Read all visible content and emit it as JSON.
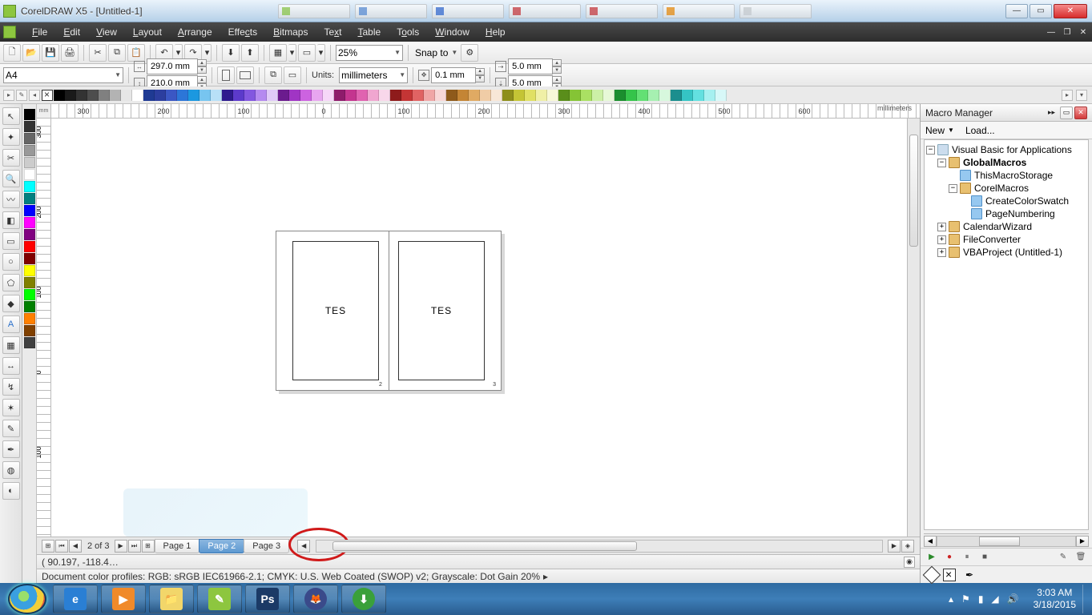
{
  "titlebar": {
    "title": "CorelDRAW X5 - [Untitled-1]",
    "tabs": [
      "",
      "",
      "",
      "",
      "",
      "",
      ""
    ]
  },
  "menu": {
    "items": [
      "File",
      "Edit",
      "View",
      "Layout",
      "Arrange",
      "Effects",
      "Bitmaps",
      "Text",
      "Table",
      "Tools",
      "Window",
      "Help"
    ]
  },
  "toolbar1": {
    "zoom": "25%",
    "snap_label": "Snap to"
  },
  "propbar": {
    "pagesize": "A4",
    "width": "297.0 mm",
    "height": "210.0 mm",
    "units_label": "Units:",
    "units": "millimeters",
    "nudge": "0.1 mm",
    "dup_x": "5.0 mm",
    "dup_y": "5.0 mm"
  },
  "palette": {
    "colors": [
      "#000000",
      "#1a1a1a",
      "#333333",
      "#4d4d4d",
      "#808080",
      "#b3b3b3",
      "#e6e6e6",
      "#ffffff",
      "#1f3a93",
      "#2c3e9f",
      "#3b57c4",
      "#2c76d8",
      "#1b98e0",
      "#77c5f0",
      "#b8e0f7",
      "#2e1b8e",
      "#5c3acb",
      "#8357e0",
      "#b58af0",
      "#e0caf8",
      "#6b1b8e",
      "#a035c4",
      "#cc63e0",
      "#e8a6f0",
      "#f6d7f8",
      "#8e1b6b",
      "#c4358f",
      "#e063b0",
      "#f0a6d0",
      "#f8d7ea",
      "#8e1b1b",
      "#c43535",
      "#e06363",
      "#f0a6a6",
      "#f8d7d7",
      "#8e5a1b",
      "#c48535",
      "#e0aa63",
      "#f0cca6",
      "#f8e7d7",
      "#8e8e1b",
      "#c4c435",
      "#e0e063",
      "#f0f0a6",
      "#f8f8d7",
      "#5a8e1b",
      "#85c435",
      "#aae063",
      "#ccf0a6",
      "#e7f8d7",
      "#1b8e2e",
      "#35c44a",
      "#63e074",
      "#a6f0b1",
      "#d7f8dd",
      "#1b8e8e",
      "#35c4c4",
      "#63e0e0",
      "#a6f0f0",
      "#d7f8f8"
    ]
  },
  "sidepalette": {
    "colors": [
      "#000000",
      "#333333",
      "#666666",
      "#999999",
      "#cccccc",
      "#ffffff",
      "#00ffff",
      "#008080",
      "#0000ff",
      "#ff00ff",
      "#800080",
      "#ff0000",
      "#800000",
      "#ffff00",
      "#808000",
      "#00ff00",
      "#008000",
      "#ff8000",
      "#804000",
      "#404040"
    ]
  },
  "ruler": {
    "unit": "millimeters",
    "h_ticks": [
      "300",
      "200",
      "100",
      "0",
      "100",
      "200",
      "300",
      "400",
      "500",
      "600"
    ],
    "v_ticks": [
      "300",
      "200",
      "100",
      "0",
      "100"
    ]
  },
  "canvas": {
    "page_left_text": "TES",
    "page_right_text": "TES",
    "page_left_num": "2",
    "page_right_num": "3"
  },
  "pagetabs": {
    "count": "2 of 3",
    "tabs": [
      "Page 1",
      "Page 2",
      "Page 3"
    ],
    "active_index": 1
  },
  "status": {
    "coords": "( 90.197, -118.4…",
    "profiles": "Document color profiles: RGB: sRGB IEC61966-2.1; CMYK: U.S. Web Coated (SWOP) v2; Grayscale: Dot Gain 20%"
  },
  "docker": {
    "title": "Macro Manager",
    "new": "New",
    "load": "Load...",
    "tree": {
      "root": "Visual Basic for Applications",
      "global": "GlobalMacros",
      "storage": "ThisMacroStorage",
      "corel": "CorelMacros",
      "swatch": "CreateColorSwatch",
      "pagenum": "PageNumbering",
      "calendar": "CalendarWizard",
      "fileconv": "FileConverter",
      "vbaproj": "VBAProject (Untitled-1)"
    }
  },
  "taskbar": {
    "time": "3:03 AM",
    "date": "3/18/2015"
  }
}
